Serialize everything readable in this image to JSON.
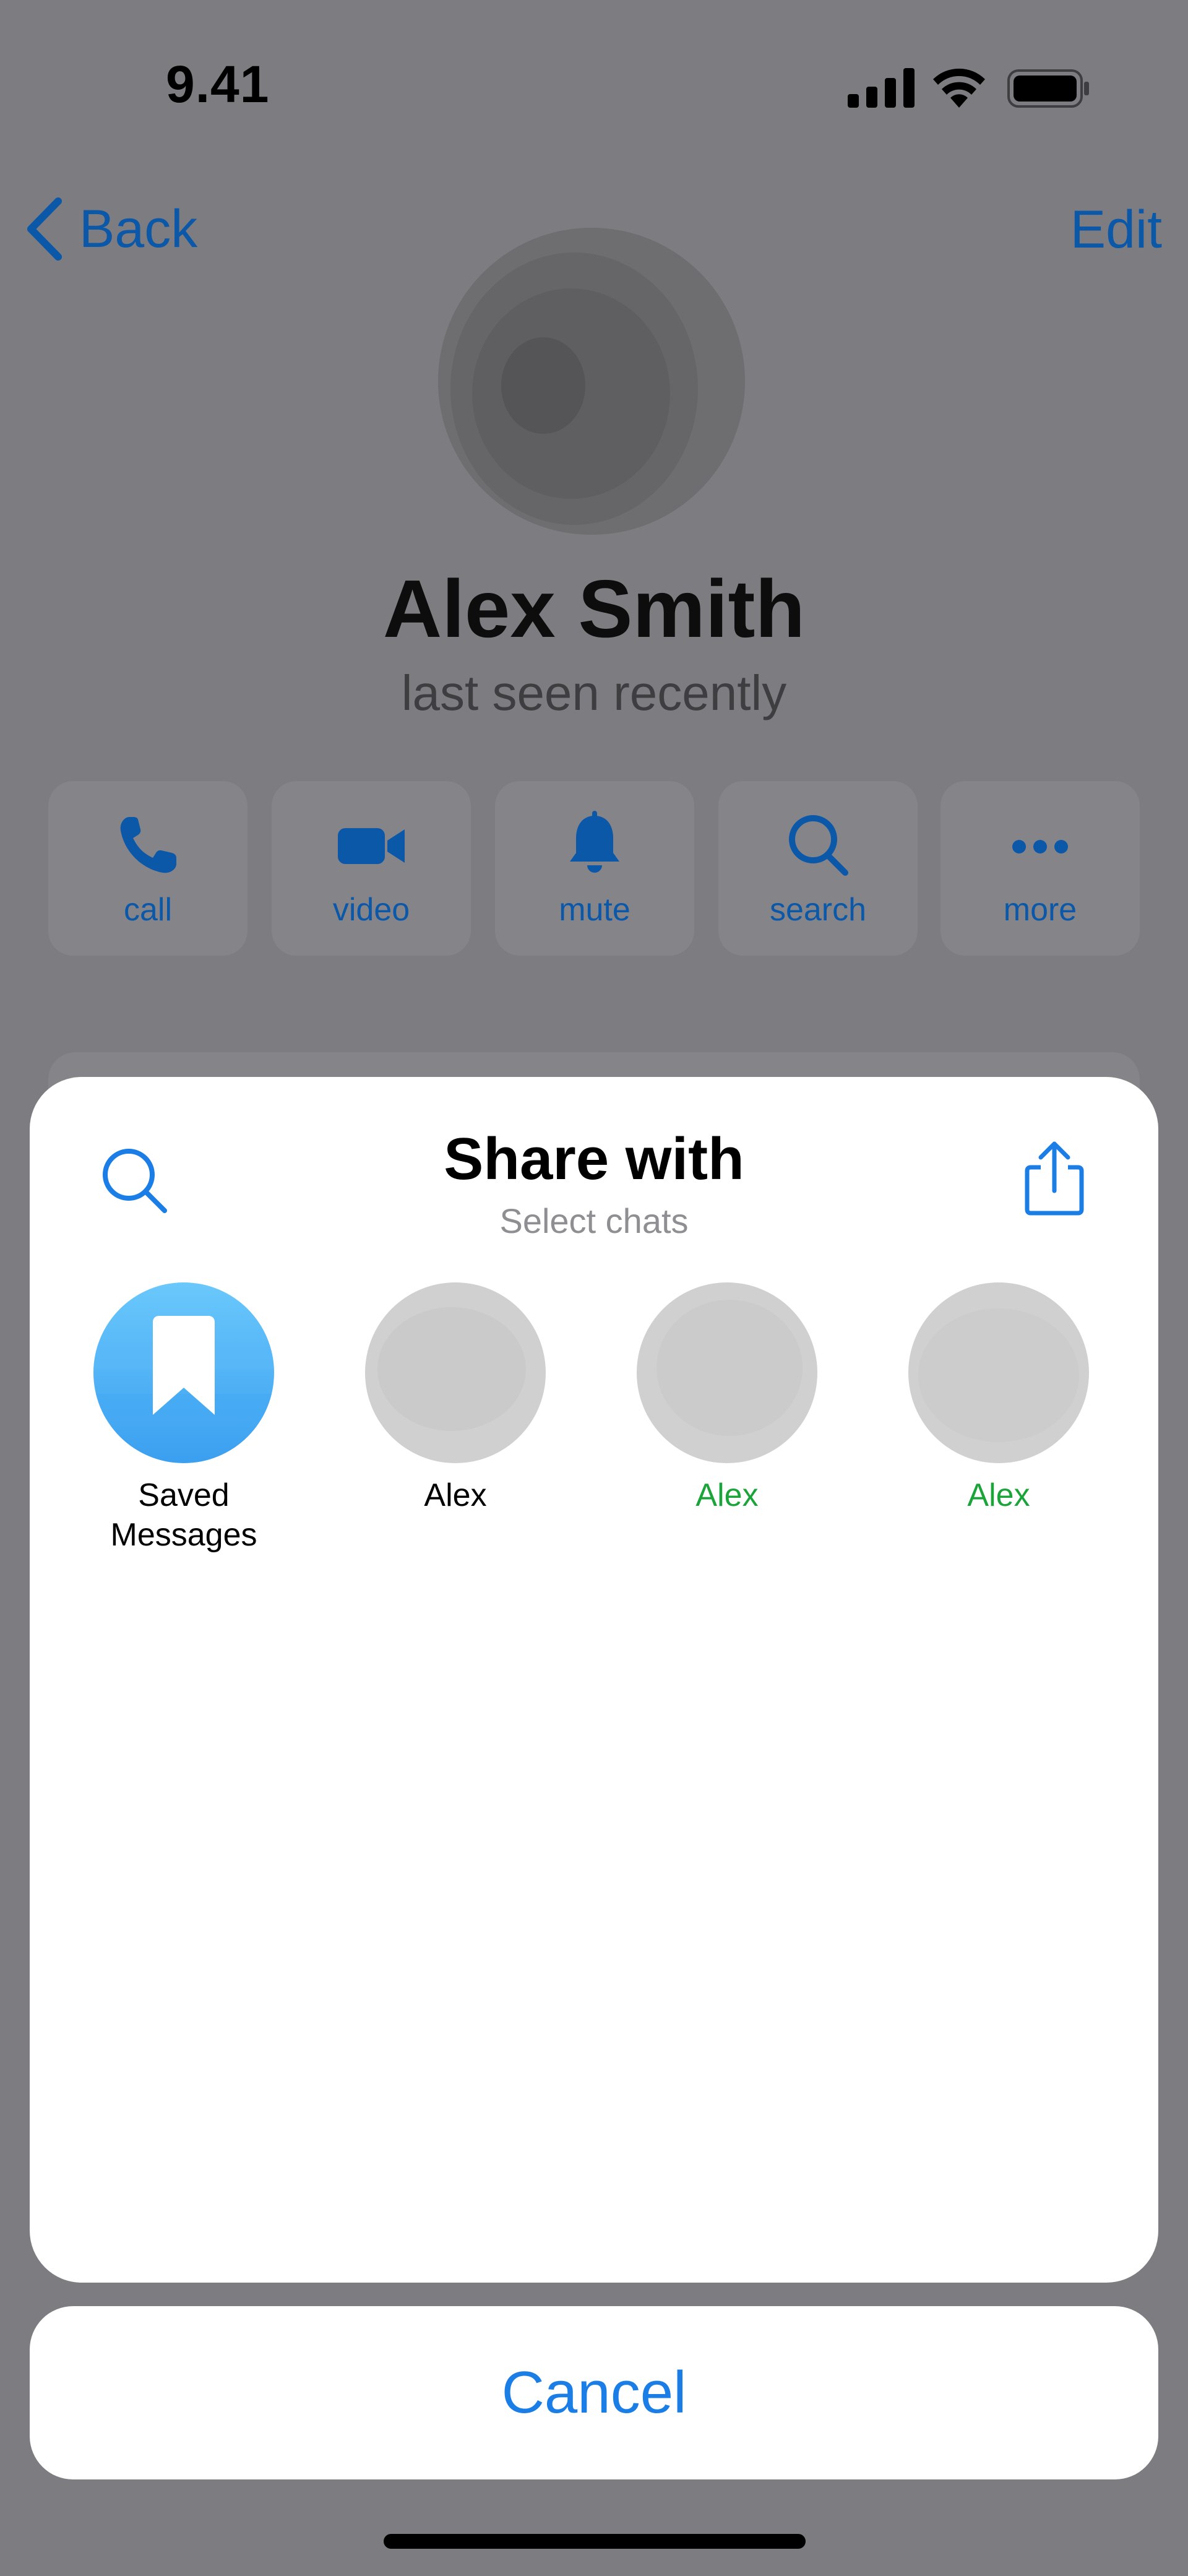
{
  "status_bar": {
    "time": "9.41"
  },
  "nav": {
    "back_label": "Back",
    "edit_label": "Edit"
  },
  "profile": {
    "name": "Alex Smith",
    "status": "last seen recently"
  },
  "actions": [
    {
      "label": "call",
      "icon": "phone-icon"
    },
    {
      "label": "video",
      "icon": "video-camera-icon"
    },
    {
      "label": "mute",
      "icon": "bell-icon"
    },
    {
      "label": "search",
      "icon": "search-icon"
    },
    {
      "label": "more",
      "icon": "more-dots-icon"
    }
  ],
  "share_sheet": {
    "title": "Share with",
    "subtitle": "Select chats",
    "chats": [
      {
        "name": "Saved Messages",
        "icon": "bookmark-icon",
        "color": "#000000"
      },
      {
        "name": "Alex",
        "color": "#000000"
      },
      {
        "name": "Alex",
        "color": "#1aa43a"
      },
      {
        "name": "Alex",
        "color": "#1aa43a"
      }
    ]
  },
  "cancel_label": "Cancel",
  "colors": {
    "accent": "#1a7ee6",
    "dimmed_accent": "#0b57a8",
    "online_green": "#1aa43a",
    "overlay": "#7d7d81"
  }
}
